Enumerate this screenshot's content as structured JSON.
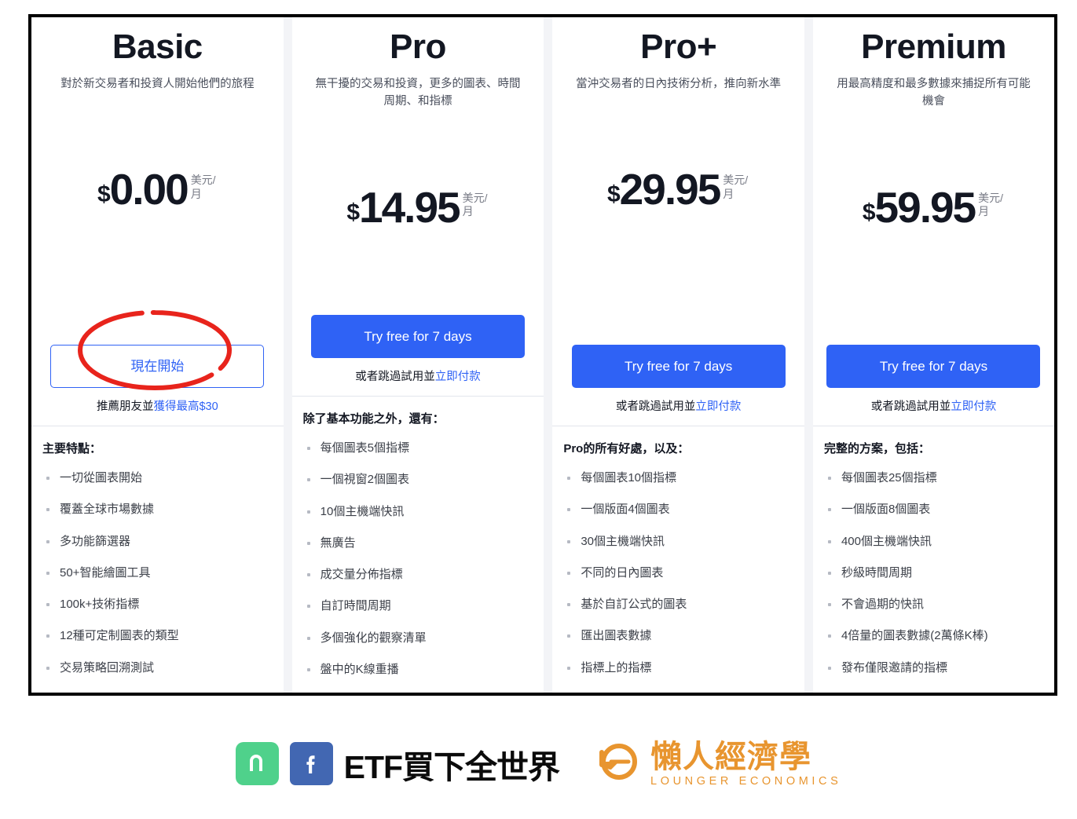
{
  "colors": {
    "accent_blue": "#2f62f5",
    "annotation_red": "#E8241C",
    "frame_black": "#000000",
    "brand_green": "#4fd18b",
    "brand_facebook_blue": "#4267b2",
    "brand_orange": "#e8952f",
    "muted_text": "#787b86"
  },
  "plans": [
    {
      "name": "Basic",
      "description": "對於新交易者和投資人開始他們的旅程",
      "currency_symbol": "$",
      "price": "0.00",
      "price_unit": "美元/月",
      "cta_label": "現在開始",
      "cta_style": "outlined",
      "sub_text": "推薦朋友並",
      "sub_link": "獲得最高$30",
      "annotated": true,
      "features_title": "主要特點：",
      "features": [
        "一切從圖表開始",
        "覆蓋全球市場數據",
        "多功能篩選器",
        "50+智能繪圖工具",
        "100k+技術指標",
        "12種可定制圖表的類型",
        "交易策略回溯測試"
      ]
    },
    {
      "name": "Pro",
      "description": "無干擾的交易和投資，更多的圖表、時間周期、和指標",
      "currency_symbol": "$",
      "price": "14.95",
      "price_unit": "美元/月",
      "cta_label": "Try free for 7 days",
      "cta_style": "filled",
      "sub_text": "或者跳過試用並",
      "sub_link": "立即付款",
      "annotated": false,
      "features_title": "除了基本功能之外，還有：",
      "features": [
        "每個圖表5個指標",
        "一個視窗2個圖表",
        "10個主機端快訊",
        "無廣告",
        "成交量分佈指標",
        "自訂時間周期",
        "多個強化的觀察清單",
        "盤中的K線重播"
      ]
    },
    {
      "name": "Pro+",
      "description": "當沖交易者的日內技術分析，推向新水準",
      "currency_symbol": "$",
      "price": "29.95",
      "price_unit": "美元/月",
      "cta_label": "Try free for 7 days",
      "cta_style": "filled",
      "sub_text": "或者跳過試用並",
      "sub_link": "立即付款",
      "annotated": false,
      "features_title": "Pro的所有好處，以及：",
      "features": [
        "每個圖表10個指標",
        "一個版面4個圖表",
        "30個主機端快訊",
        "不同的日內圖表",
        "基於自訂公式的圖表",
        "匯出圖表數據",
        "指標上的指標"
      ]
    },
    {
      "name": "Premium",
      "description": "用最高精度和最多數據來捕捉所有可能機會",
      "currency_symbol": "$",
      "price": "59.95",
      "price_unit": "美元/月",
      "cta_label": "Try free for 7 days",
      "cta_style": "filled",
      "sub_text": "或者跳過試用並",
      "sub_link": "立即付款",
      "annotated": false,
      "features_title": "完整的方案，包括：",
      "features": [
        "每個圖表25個指標",
        "一個版面8個圖表",
        "400個主機端快訊",
        "秒級時間周期",
        "不會過期的快訊",
        "4倍量的圖表數據(2萬條K棒)",
        "發布僅限邀請的指標"
      ]
    }
  ],
  "footer": {
    "left_logo_icon": "app-logo-icon",
    "facebook_icon": "facebook-icon",
    "left_brand_text": "ETF買下全世界",
    "right_logo_icon": "lounger-economics-logo-icon",
    "right_brand_cn": "懶人經濟學",
    "right_brand_en": "LOUNGER ECONOMICS"
  }
}
